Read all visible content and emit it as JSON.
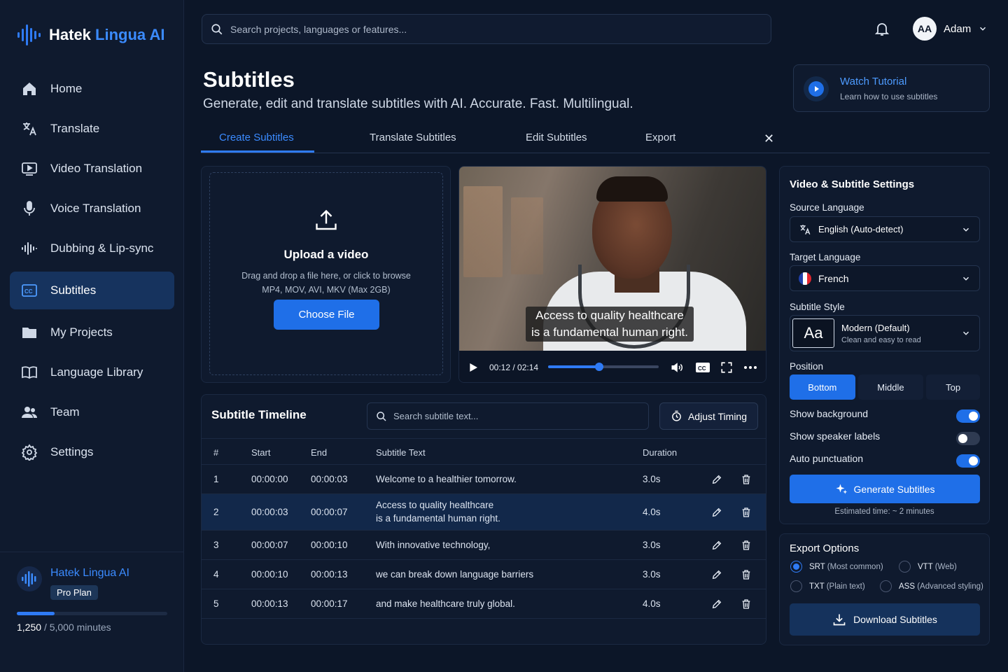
{
  "app": {
    "name_part1": "Hatek",
    "name_part2": "Lingua AI"
  },
  "sidebar": {
    "items": [
      {
        "label": "Home",
        "icon": "home-icon"
      },
      {
        "label": "Translate",
        "icon": "translate-icon"
      },
      {
        "label": "Video Translation",
        "icon": "video-icon"
      },
      {
        "label": "Voice Translation",
        "icon": "microphone-icon"
      },
      {
        "label": "Dubbing & Lip-sync",
        "icon": "waveform-icon"
      },
      {
        "label": "Subtitles",
        "icon": "cc-icon",
        "active": true
      },
      {
        "label": "My Projects",
        "icon": "folder-icon"
      },
      {
        "label": "Language Library",
        "icon": "book-icon"
      },
      {
        "label": "Team",
        "icon": "team-icon"
      },
      {
        "label": "Settings",
        "icon": "gear-icon"
      }
    ],
    "plan": {
      "name": "Hatek Lingua AI",
      "badge": "Pro Plan",
      "used": "1,250",
      "total": "/ 5,000 minutes",
      "usage_fraction": 0.25
    }
  },
  "header": {
    "search_placeholder": "Search projects, languages or features...",
    "user_initials": "AA",
    "user_name": "Adam"
  },
  "page": {
    "title": "Subtitles",
    "subtitle": "Generate, edit and translate subtitles with AI. Accurate. Fast. Multilingual.",
    "tutorial_title": "Watch Tutorial",
    "tutorial_sub": "Learn how to use subtitles"
  },
  "tabs": [
    "Create Subtitles",
    "Translate Subtitles",
    "Edit Subtitles",
    "Export"
  ],
  "upload": {
    "title": "Upload a video",
    "desc1": "Drag and drop a file here, or click to browse",
    "desc2": "MP4, MOV, AVI, MKV (Max 2GB)",
    "button": "Choose File"
  },
  "player": {
    "caption_line1": "Access to quality healthcare",
    "caption_line2": "is a fundamental human right.",
    "time": "00:12 / 02:14",
    "progress_fraction": 0.46
  },
  "timeline": {
    "title": "Subtitle Timeline",
    "search_placeholder": "Search subtitle text...",
    "adjust_label": "Adjust Timing",
    "columns": [
      "#",
      "Start",
      "End",
      "Subtitle Text",
      "Duration"
    ],
    "rows": [
      {
        "n": "1",
        "start": "00:00:00",
        "end": "00:00:03",
        "text1": "Welcome to a healthier tomorrow.",
        "text2": "",
        "dur": "3.0s"
      },
      {
        "n": "2",
        "start": "00:00:03",
        "end": "00:00:07",
        "text1": "Access to quality healthcare",
        "text2": "is a fundamental human right.",
        "dur": "4.0s",
        "selected": true
      },
      {
        "n": "3",
        "start": "00:00:07",
        "end": "00:00:10",
        "text1": "With innovative technology,",
        "text2": "",
        "dur": "3.0s"
      },
      {
        "n": "4",
        "start": "00:00:10",
        "end": "00:00:13",
        "text1": "we can break down language barriers",
        "text2": "",
        "dur": "3.0s"
      },
      {
        "n": "5",
        "start": "00:00:13",
        "end": "00:00:17",
        "text1": "and make healthcare truly global.",
        "text2": "",
        "dur": "4.0s"
      }
    ]
  },
  "settings": {
    "title": "Video & Subtitle Settings",
    "source_label": "Source Language",
    "source_value": "English (Auto-detect)",
    "target_label": "Target Language",
    "target_value": "French",
    "style_label": "Subtitle Style",
    "style_sample": "Aa",
    "style_name": "Modern (Default)",
    "style_desc": "Clean and easy to read",
    "position_label": "Position",
    "positions": [
      "Bottom",
      "Middle",
      "Top"
    ],
    "position_selected": "Bottom",
    "toggles": [
      {
        "label": "Show background",
        "on": true
      },
      {
        "label": "Show speaker labels",
        "on": false
      },
      {
        "label": "Auto punctuation",
        "on": true
      }
    ],
    "generate_label": "Generate Subtitles",
    "estimate": "Estimated time: ~ 2 minutes",
    "accent_color": "#1f6fe8"
  },
  "export": {
    "title": "Export Options",
    "formats": [
      {
        "name": "SRT",
        "note": "(Most common)",
        "selected": true
      },
      {
        "name": "VTT",
        "note": "(Web)",
        "selected": false
      },
      {
        "name": "TXT",
        "note": "(Plain text)",
        "selected": false
      },
      {
        "name": "ASS",
        "note": "(Advanced styling)",
        "selected": false
      }
    ],
    "download_label": "Download Subtitles"
  }
}
